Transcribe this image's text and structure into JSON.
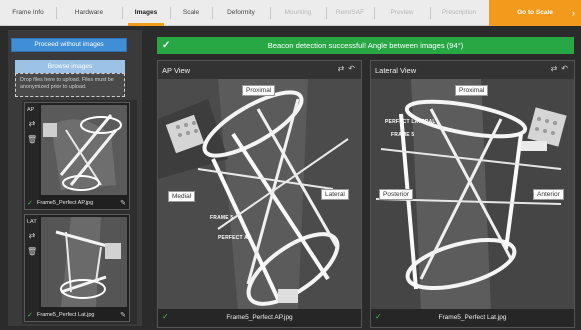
{
  "nav": {
    "tabs": [
      {
        "label": "Frame Info",
        "state": "done"
      },
      {
        "label": "Hardware",
        "state": "done"
      },
      {
        "label": "Images",
        "state": "active"
      },
      {
        "label": "Scale",
        "state": "done"
      },
      {
        "label": "Deformity",
        "state": "done"
      },
      {
        "label": "Mounting",
        "state": "disabled"
      },
      {
        "label": "Rem/SAF",
        "state": "disabled"
      },
      {
        "label": "Preview",
        "state": "disabled"
      },
      {
        "label": "Prescription",
        "state": "disabled"
      }
    ],
    "next": {
      "label": "Go to Scale",
      "arrow": "›"
    },
    "accent_color": "#f39a1c"
  },
  "upload": {
    "proceed_label": "Proceed without images",
    "browse_label": "Browse images",
    "drop_hint": "Drop files here to upload. Files must be anonymized prior to upload."
  },
  "thumbnails": [
    {
      "tag": "AP",
      "filename": "Frame5_Perfect AP.jpg"
    },
    {
      "tag": "LAT",
      "filename": "Frame5_Perfect Lat.jpg"
    }
  ],
  "banner": {
    "text": "Beacon detection successful! Angle between images (94°)",
    "color": "#27a844",
    "icon": "check-icon"
  },
  "views": {
    "ap": {
      "title": "AP View",
      "labels": {
        "top": "Proximal",
        "left": "Medial",
        "right": "Lateral"
      },
      "overlay": [
        "FRAME 5",
        "PERFECT AP"
      ],
      "filename": "Frame5_Perfect AP.jpg"
    },
    "lateral": {
      "title": "Lateral View",
      "labels": {
        "top": "Proximal",
        "left": "Posterior",
        "right": "Anterior"
      },
      "overlay": [
        "PERFECT LATERAL",
        "FRAME 5"
      ],
      "filename": "Frame5_Perfect Lat.jpg"
    }
  }
}
